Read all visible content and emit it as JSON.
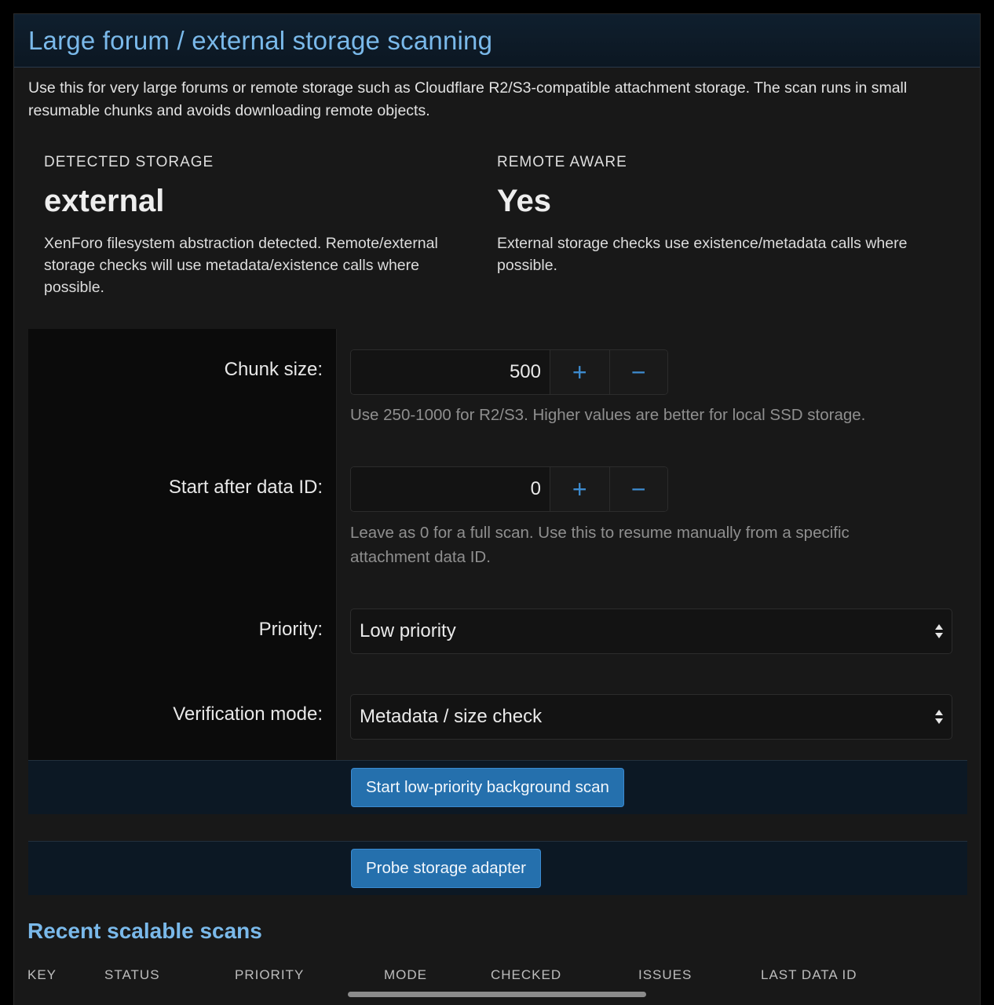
{
  "panel": {
    "title": "Large forum / external storage scanning",
    "intro": "Use this for very large forums or remote storage such as Cloudflare R2/S3-compatible attachment storage. The scan runs in small resumable chunks and avoids downloading remote objects."
  },
  "stats": [
    {
      "label": "DETECTED STORAGE",
      "value": "external",
      "desc": "XenForo filesystem abstraction detected. Remote/external storage checks will use metadata/existence calls where possible."
    },
    {
      "label": "REMOTE AWARE",
      "value": "Yes",
      "desc": "External storage checks use existence/metadata calls where possible."
    }
  ],
  "form": {
    "chunk": {
      "label": "Chunk size:",
      "value": "500",
      "hint": "Use 250-1000 for R2/S3. Higher values are better for local SSD storage."
    },
    "start_after": {
      "label": "Start after data ID:",
      "value": "0",
      "hint": "Leave as 0 for a full scan. Use this to resume manually from a specific attachment data ID."
    },
    "priority": {
      "label": "Priority:",
      "selected": "Low priority"
    },
    "verification": {
      "label": "Verification mode:",
      "selected": "Metadata / size check"
    },
    "increment_symbol": "+",
    "decrement_symbol": "−"
  },
  "buttons": {
    "start_scan": "Start low-priority background scan",
    "probe": "Probe storage adapter"
  },
  "recent": {
    "title": "Recent scalable scans",
    "columns": [
      "KEY",
      "STATUS",
      "PRIORITY",
      "MODE",
      "CHECKED",
      "ISSUES",
      "LAST DATA ID"
    ]
  },
  "colors": {
    "accent": "#7ab9ea",
    "button": "#2570ad",
    "stepper_icon": "#3d8bcf",
    "background": "#181818"
  }
}
